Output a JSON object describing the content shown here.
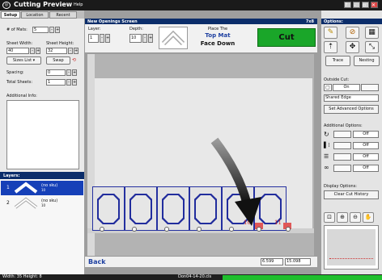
{
  "app": {
    "title": "Cutting Preview",
    "help": "Help"
  },
  "window_buttons": [
    "?",
    "–",
    "▫",
    "✕"
  ],
  "tabs": [
    {
      "label": "Setup"
    },
    {
      "label": "Location"
    },
    {
      "label": "Recent"
    }
  ],
  "setup": {
    "mats_label": "# of Mats:",
    "mats_value": "5",
    "sheet_width_label": "Sheet Width:",
    "sheet_width_value": "40",
    "sheet_height_label": "Sheet Height:",
    "sheet_height_value": "32",
    "sizes_list": "Sizes List ▾",
    "swap": "Swap",
    "spacing_label": "Spacing:",
    "spacing_value": "0",
    "total_sheets_label": "Total Sheets:",
    "total_sheets_value": "1",
    "additional_info_label": "Additional Info:"
  },
  "layers": {
    "header": "Layers:",
    "items": [
      {
        "num": "1",
        "name": "(no sku)",
        "sub": "10"
      },
      {
        "num": "2",
        "name": "(no sku)",
        "sub": "10"
      }
    ]
  },
  "screen": {
    "header": "New Openings Screen",
    "zoom": "7x8"
  },
  "toolbar": {
    "layer_label": "Layer:",
    "layer_value": "1",
    "depth_label": "Depth:",
    "depth_value": "10",
    "place_line1": "Place The",
    "place_line2": "Top Mat",
    "place_line3": "Face Down",
    "cut_label": "Cut"
  },
  "mat": {
    "count_labels": [
      "10",
      "11"
    ]
  },
  "bottom": {
    "back_label": "Back",
    "coord_x": "6.599",
    "coord_y": "15.098"
  },
  "options": {
    "header": "Options:",
    "trace_label": "Trace",
    "nesting_label": "Nesting",
    "outside_cut_label": "Outside Cut:",
    "outside_cut_value": "On",
    "shared_edge": "Shared Edge",
    "advanced_label": "Set Advanced Options",
    "additional_options_label": "Additional Options:",
    "additional_options": [
      {
        "state": "Off"
      },
      {
        "state": "Off"
      },
      {
        "state": "Off"
      },
      {
        "state": "Off"
      }
    ],
    "display_options_label": "Display Options:",
    "clear_history_label": "Clear Cut History"
  },
  "status": {
    "dims": "Width: 35  Height: 8",
    "file": "Don04-14-20.cls"
  },
  "colors": {
    "accent": "#0b2d6a",
    "cut_button": "#1aa629",
    "progress": "#1fbf2d",
    "mat_line": "#2430a0"
  }
}
